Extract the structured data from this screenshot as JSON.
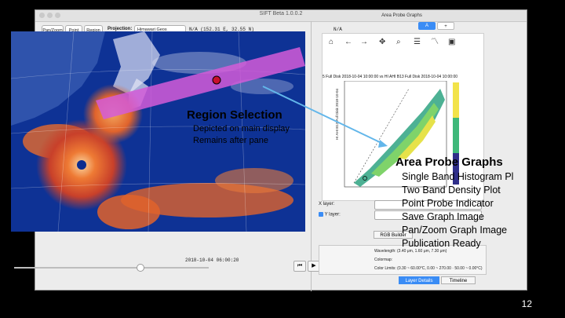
{
  "window": {
    "title": "SIFT Beta 1.0.0.2"
  },
  "toolbar": {
    "pan_zoom": "Pan/Zoom",
    "point": "Point",
    "region": "Region",
    "projection_label": "Projection:",
    "projection_value": "Himawari Geos",
    "coordinates": "N/A  (152.31 E,   32.55 N)",
    "value_readout": "N/A"
  },
  "right_panel": {
    "title": "Area Probe Graphs",
    "tab_a": "A",
    "tab_add": "+",
    "graph_toolbar_icons": [
      "home-icon",
      "back-arrow-icon",
      "forward-arrow-icon",
      "pan-icon",
      "zoom-icon",
      "configure-subplots-icon",
      "edit-axis-icon",
      "save-icon"
    ],
    "graph_title_fragment": "5 Full Disk 2018-10-04 10:00:00 vs HI AHI B13 Full Disk 2018-10-04 10:00:00",
    "y_axis_label": "HI AHI B13 Full Disk 2018-10-04",
    "colorbar_label": "log(count of data points)",
    "x_layer_label": "X layer:",
    "y_layer_label": "Y layer:",
    "layer_tab_rgb": "RGB Builder",
    "layer_tab_details": "Layer Details",
    "timeline_tab": "Timeline"
  },
  "details": {
    "wavelength": "Wavelength: (3.40 μm, 1.60 μm, 7.30 μm)",
    "colormap": "Colormap:",
    "color_limits": "Color Limits: (0.30 ~ 60.00°C, 0.00 ~ 270.00 · 50.00 ~ 0.00°C)"
  },
  "timeline": {
    "timestamp": "2018-10-04 06:00:20"
  },
  "annotations": {
    "region_title": "Region Selection",
    "region_lines": [
      "Depicted on main display",
      "Remains after pane"
    ],
    "area_title": "Area Probe Graphs",
    "area_lines": [
      "Single Band Histogram Pl",
      "Two Band Density Plot",
      "Point Probe Indicator",
      "Save Graph Image",
      "Pan/Zoom Graph Image",
      "Publication Ready"
    ]
  },
  "slide_number": "12",
  "colors": {
    "region_band": "#d45cd8",
    "arrow": "#62b6ea",
    "map_ocean": "#0b2a8a",
    "clouds": "#e8622a"
  }
}
